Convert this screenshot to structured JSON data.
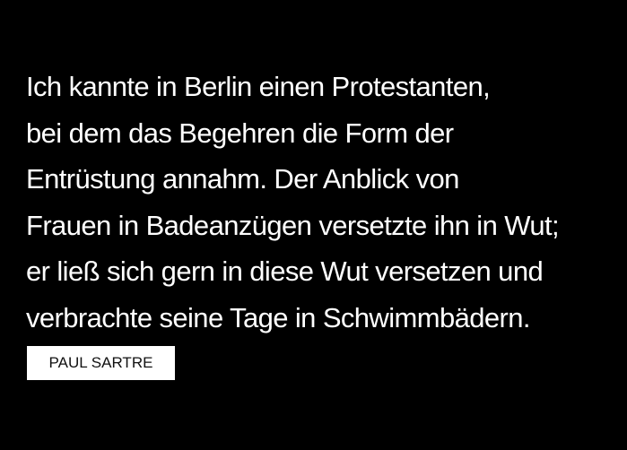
{
  "quote": {
    "lines": [
      "Ich kannte in Berlin einen Protestanten,",
      "bei dem das Begehren die Form der",
      "Entrüstung annahm. Der Anblick von",
      "Frauen in Badeanzügen versetzte ihn in Wut;",
      "er ließ sich gern in diese Wut versetzen und",
      "verbrachte seine Tage in Schwimmbädern."
    ]
  },
  "author": {
    "label": "PAUL SARTRE"
  },
  "colors": {
    "background": "#000000",
    "text": "#ffffff",
    "author_box": "#ffffff",
    "author_text": "#111111"
  }
}
